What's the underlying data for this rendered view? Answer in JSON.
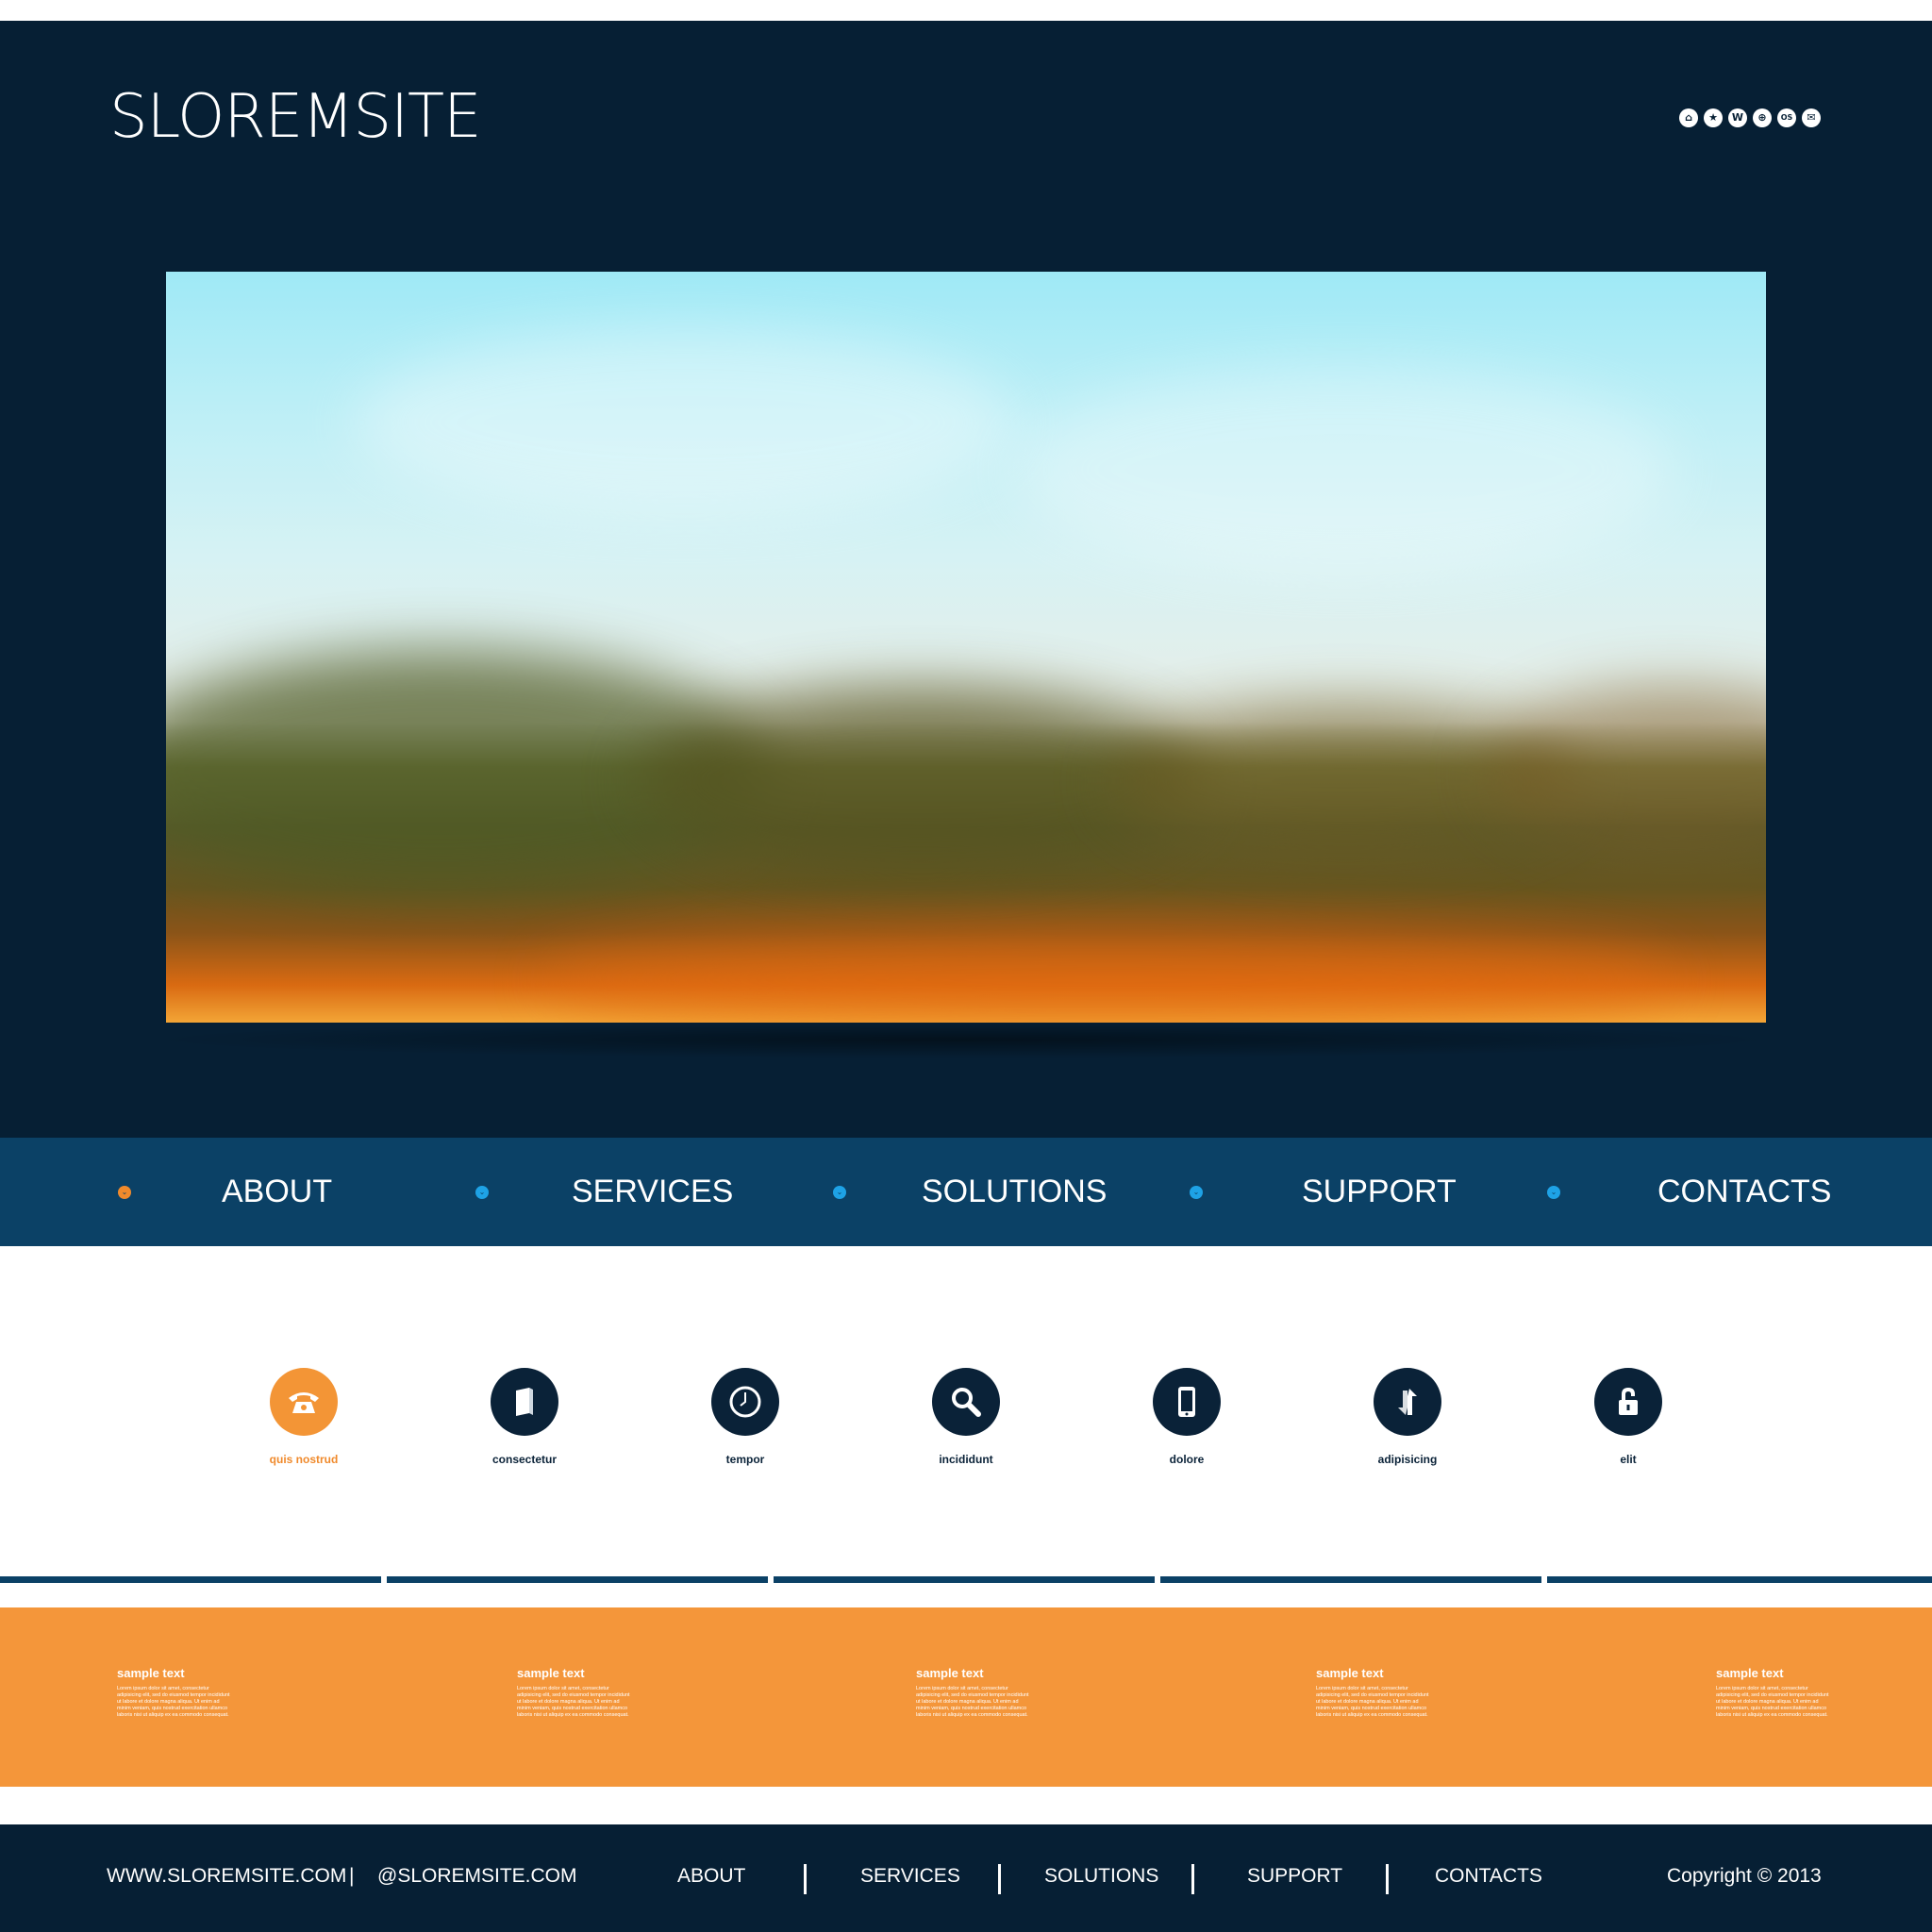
{
  "site": {
    "logo": "SLOREMSITE"
  },
  "header": {
    "social_icons": [
      "home-icon",
      "star-icon",
      "wordpress-icon",
      "target-icon",
      "os-icon",
      "mail-icon"
    ],
    "social_glyphs": [
      "⌂",
      "★",
      "W",
      "⊕",
      "OS",
      "✉"
    ]
  },
  "nav": {
    "items": [
      {
        "label": "ABOUT",
        "active": true
      },
      {
        "label": "SERVICES",
        "active": false
      },
      {
        "label": "SOLUTIONS",
        "active": false
      },
      {
        "label": "SUPPORT",
        "active": false
      },
      {
        "label": "CONTACTS",
        "active": false
      }
    ]
  },
  "features": [
    {
      "icon": "phone-icon",
      "label": "quis nostrud",
      "active": true
    },
    {
      "icon": "book-icon",
      "label": "consectetur",
      "active": false
    },
    {
      "icon": "clock-icon",
      "label": "tempor",
      "active": false
    },
    {
      "icon": "search-icon",
      "label": "incididunt",
      "active": false
    },
    {
      "icon": "mobile-icon",
      "label": "dolore",
      "active": false
    },
    {
      "icon": "exchange-icon",
      "label": "adipisicing",
      "active": false
    },
    {
      "icon": "lock-icon",
      "label": "elit",
      "active": false
    }
  ],
  "band": {
    "columns": [
      {
        "title": "sample text",
        "body": "Lorem ipsum dolor sit amet, consectetur adipisicing elit, sed do eiusmod tempor incididunt ut labore et dolore magna aliqua. Ut enim ad minim veniam, quis nostrud exercitation ullamco laboris nisi ut aliquip ex ea commodo consequat."
      },
      {
        "title": "sample text",
        "body": "Lorem ipsum dolor sit amet, consectetur adipisicing elit, sed do eiusmod tempor incididunt ut labore et dolore magna aliqua. Ut enim ad minim veniam, quis nostrud exercitation ullamco laboris nisi ut aliquip ex ea commodo consequat."
      },
      {
        "title": "sample text",
        "body": "Lorem ipsum dolor sit amet, consectetur adipisicing elit, sed do eiusmod tempor incididunt ut labore et dolore magna aliqua. Ut enim ad minim veniam, quis nostrud exercitation ullamco laboris nisi ut aliquip ex ea commodo consequat."
      },
      {
        "title": "sample text",
        "body": "Lorem ipsum dolor sit amet, consectetur adipisicing elit, sed do eiusmod tempor incididunt ut labore et dolore magna aliqua. Ut enim ad minim veniam, quis nostrud exercitation ullamco laboris nisi ut aliquip ex ea commodo consequat."
      },
      {
        "title": "sample text",
        "body": "Lorem ipsum dolor sit amet, consectetur adipisicing elit, sed do eiusmod tempor incididunt ut labore et dolore magna aliqua. Ut enim ad minim veniam, quis nostrud exercitation ullamco laboris nisi ut aliquip ex ea commodo consequat."
      }
    ]
  },
  "footer": {
    "website": "WWW.SLOREMSITE.COM",
    "separator": "|",
    "handle": "@SLOREMSITE.COM",
    "links": [
      "ABOUT",
      "SERVICES",
      "SOLUTIONS",
      "SUPPORT",
      "CONTACTS"
    ],
    "copyright": "Copyright © 2013"
  },
  "colors": {
    "header_bg": "#061f34",
    "nav_bg": "#0b4166",
    "accent": "#f4963a",
    "nav_dot": "#1ea2e6",
    "icon_circle": "#0a2238"
  }
}
